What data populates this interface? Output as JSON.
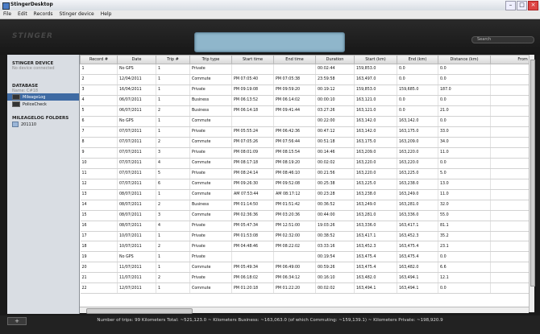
{
  "window": {
    "title": "StingerDesktop"
  },
  "menu": {
    "items": [
      "File",
      "Edit",
      "Records",
      "Stinger device",
      "Help"
    ]
  },
  "header": {
    "logo": "STINGER",
    "search_placeholder": "Search"
  },
  "sidebar": {
    "device_heading": "STINGER DEVICE",
    "device_status": "No device connected",
    "database_heading": "DATABASE",
    "database_name": "Name: C#18",
    "database_items": [
      {
        "label": "MileageLog",
        "selected": true
      },
      {
        "label": "PoliceCheck",
        "selected": false
      }
    ],
    "folders_heading": "MILEAGELOG FOLDERS",
    "folders": [
      {
        "label": "201110"
      }
    ]
  },
  "table": {
    "columns": [
      "Record #",
      "Date",
      "Trip #",
      "Trip type",
      "Start time",
      "End time",
      "Duration",
      "Start (km)",
      "End (km)",
      "Distance (km)",
      "From postal"
    ],
    "rows": [
      [
        "1",
        "No GPS",
        "1",
        "Private",
        "",
        "",
        "00:02:44",
        "159,853.0",
        "0.0",
        "0.0",
        ""
      ],
      [
        "2",
        "12/04/2011",
        "1",
        "Commute",
        "PM 07:05:40",
        "PM 07:05:38",
        "23:59:58",
        "163,497.0",
        "0.0",
        "0.0",
        ""
      ],
      [
        "3",
        "16/04/2011",
        "1",
        "Private",
        "PM 09:19:08",
        "PM 09:59:20",
        "00:19:12",
        "159,853.0",
        "159,685.0",
        "187.0",
        ""
      ],
      [
        "4",
        "06/07/2011",
        "1",
        "Business",
        "PM 06:13:52",
        "PM 06:14:02",
        "00:00:10",
        "163,121.0",
        "0.0",
        "0.0",
        ""
      ],
      [
        "5",
        "06/07/2011",
        "2",
        "Business",
        "PM 06:14:18",
        "PM 09:41:44",
        "03:27:26",
        "163,121.0",
        "0.0",
        "21.0",
        ""
      ],
      [
        "6",
        "No GPS",
        "1",
        "Commute",
        "",
        "",
        "00:22:00",
        "163,142.0",
        "163,142.0",
        "0.0",
        ""
      ],
      [
        "7",
        "07/07/2011",
        "1",
        "Private",
        "PM 05:55:24",
        "PM 06:42:36",
        "00:47:12",
        "163,142.0",
        "163,175.0",
        "33.0",
        ""
      ],
      [
        "8",
        "07/07/2011",
        "2",
        "Commute",
        "PM 07:05:26",
        "PM 07:56:44",
        "00:51:18",
        "163,175.0",
        "163,209.0",
        "34.0",
        ""
      ],
      [
        "9",
        "07/07/2011",
        "3",
        "Private",
        "PM 08:01:09",
        "PM 08:15:54",
        "00:14:46",
        "163,209.0",
        "163,220.0",
        "11.0",
        ""
      ],
      [
        "10",
        "07/07/2011",
        "4",
        "Commute",
        "PM 08:17:18",
        "PM 08:19:20",
        "00:02:02",
        "163,220.0",
        "163,220.0",
        "0.0",
        ""
      ],
      [
        "11",
        "07/07/2011",
        "5",
        "Private",
        "PM 08:24:14",
        "PM 08:46:10",
        "00:21:56",
        "163,220.0",
        "163,225.0",
        "5.0",
        ""
      ],
      [
        "12",
        "07/07/2011",
        "6",
        "Commute",
        "PM 09:26:30",
        "PM 09:52:08",
        "00:25:38",
        "163,225.0",
        "163,238.0",
        "13.0",
        ""
      ],
      [
        "13",
        "08/07/2011",
        "1",
        "Commute",
        "AM 07:53:44",
        "AM 08:17:12",
        "00:23:28",
        "163,238.0",
        "163,249.0",
        "11.0",
        ""
      ],
      [
        "14",
        "08/07/2011",
        "2",
        "Business",
        "PM 01:14:50",
        "PM 01:51:42",
        "00:36:52",
        "163,249.0",
        "163,281.0",
        "32.0",
        ""
      ],
      [
        "15",
        "08/07/2011",
        "3",
        "Commute",
        "PM 02:36:36",
        "PM 03:20:36",
        "00:44:00",
        "163,281.0",
        "163,336.0",
        "55.0",
        ""
      ],
      [
        "16",
        "08/07/2011",
        "4",
        "Private",
        "PM 05:47:34",
        "PM 12:51:00",
        "19:03:26",
        "163,336.0",
        "163,417.1",
        "81.1",
        ""
      ],
      [
        "17",
        "10/07/2011",
        "1",
        "Private",
        "PM 01:53:08",
        "PM 02:32:00",
        "00:38:52",
        "163,417.1",
        "163,452.3",
        "35.2",
        ""
      ],
      [
        "18",
        "10/07/2011",
        "2",
        "Private",
        "PM 04:48:46",
        "PM 08:22:02",
        "03:33:16",
        "163,452.3",
        "163,475.4",
        "23.1",
        ""
      ],
      [
        "19",
        "No GPS",
        "1",
        "Private",
        "",
        "",
        "00:19:54",
        "163,475.4",
        "163,475.4",
        "0.0",
        ""
      ],
      [
        "20",
        "11/07/2011",
        "1",
        "Commute",
        "PM 05:49:34",
        "PM 06:49:00",
        "00:59:26",
        "163,475.4",
        "163,482.0",
        "6.6",
        ""
      ],
      [
        "21",
        "11/07/2011",
        "2",
        "Private",
        "PM 06:18:02",
        "PM 06:34:12",
        "00:16:10",
        "163,482.0",
        "163,494.1",
        "12.1",
        ""
      ],
      [
        "22",
        "12/07/2011",
        "1",
        "Commute",
        "PM 01:20:18",
        "PM 01:22:20",
        "00:02:02",
        "163,494.1",
        "163,494.1",
        "0.0",
        ""
      ]
    ]
  },
  "status": {
    "add_button_label": "+",
    "summary": "Number of trips: 99    Kilometers Total: ~521,123.0 ~ Kilometers Business: ~163,063.0 (of which Commuting: ~159,139.1) ~ Kilometers Private: ~198,920.9"
  }
}
